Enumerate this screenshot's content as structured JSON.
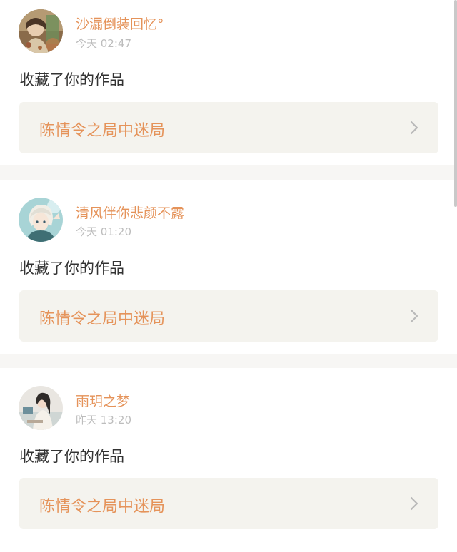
{
  "notifications": [
    {
      "username": "沙漏倒装回忆°",
      "time": "今天 02:47",
      "action": "收藏了你的作品",
      "work_title": "陈情令之局中迷局",
      "avatar": "avatar-photo-icon"
    },
    {
      "username": "清风伴你悲颜不露",
      "time": "今天 01:20",
      "action": "收藏了你的作品",
      "work_title": "陈情令之局中迷局",
      "avatar": "avatar-anime-icon"
    },
    {
      "username": "雨玥之梦",
      "time": "昨天 13:20",
      "action": "收藏了你的作品",
      "work_title": "陈情令之局中迷局",
      "avatar": "avatar-girl-icon"
    }
  ],
  "colors": {
    "accent": "#e5935a",
    "timestamp": "#bdbdbd",
    "action_text": "#333333",
    "link_background": "#f4f3ee",
    "page_background": "#f7f6f4"
  },
  "icons": {
    "chevron": "chevron-right-icon"
  }
}
